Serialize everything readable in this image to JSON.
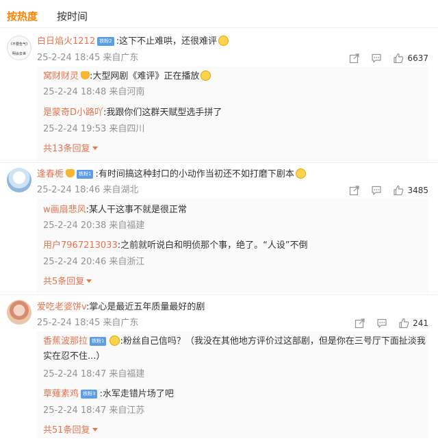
{
  "tabs": [
    "按热度",
    "按时间"
  ],
  "comments": [
    {
      "user": "白日焰火1212",
      "badge": "铁粉2",
      "text": ":这下不止难哄，还很难评",
      "time": "25-2-24 18:45",
      "location": "来自广东",
      "likes": "6637",
      "avatar_text": [
        "《不要告气》",
        "明会去世"
      ],
      "replies": [
        {
          "user": "窝财财灵",
          "text": ":大型网剧《难评》正在播放",
          "time": "25-2-24 18:48",
          "location": "来自河南"
        },
        {
          "user": "是蒙奇D小路吖",
          "text": ":我跟你们这群天赋型选手拼了",
          "time": "25-2-24 19:53",
          "location": "来自四川"
        }
      ],
      "more": "共13条回复"
    },
    {
      "user": "逢春栀",
      "badge": "铁粉1",
      "text": ":有时间搞这种封口的小动作当初还不如打磨下剧本",
      "time": "25-2-24 18:46",
      "location": "来自湖北",
      "likes": "3485",
      "replies": [
        {
          "user": "w画扇悲风",
          "text": ":某人干这事不就是很正常",
          "time": "25-2-24 20:38",
          "location": "来自福建"
        },
        {
          "user": "用户7967213033",
          "text": ":之前就听说白和明侦那个事，绝了。“人设”不倒",
          "time": "25-2-24 20:46",
          "location": "来自浙江"
        }
      ],
      "more": "共5条回复"
    },
    {
      "user": "爱吃老婆饼v",
      "text": ":掌心是最近五年质量最好的剧",
      "time": "25-2-24 18:45",
      "location": "来自广东",
      "likes": "241",
      "replies": [
        {
          "user": "香蕉波那拉",
          "badge": "铁粉1",
          "text": ":粉丝自己信吗？（我没在其他地方评价过这部剧，但是你在三号厅下面扯淡我实在忍不住...）",
          "time": "25-2-24 18:47",
          "location": "来自福建"
        },
        {
          "user": "草薙素鸡",
          "badge": "铁粉3",
          "text": ":水军走错片场了吧",
          "time": "25-2-24 18:47",
          "location": "来自江苏"
        }
      ],
      "more": "共51条回复"
    }
  ],
  "colors": {
    "accent": "#ff8200",
    "username": "#eb7350",
    "meta": "#939393",
    "badge": "#5a9de8"
  },
  "icons": [
    "share-icon",
    "comment-icon",
    "like-icon",
    "caret-down-icon"
  ]
}
